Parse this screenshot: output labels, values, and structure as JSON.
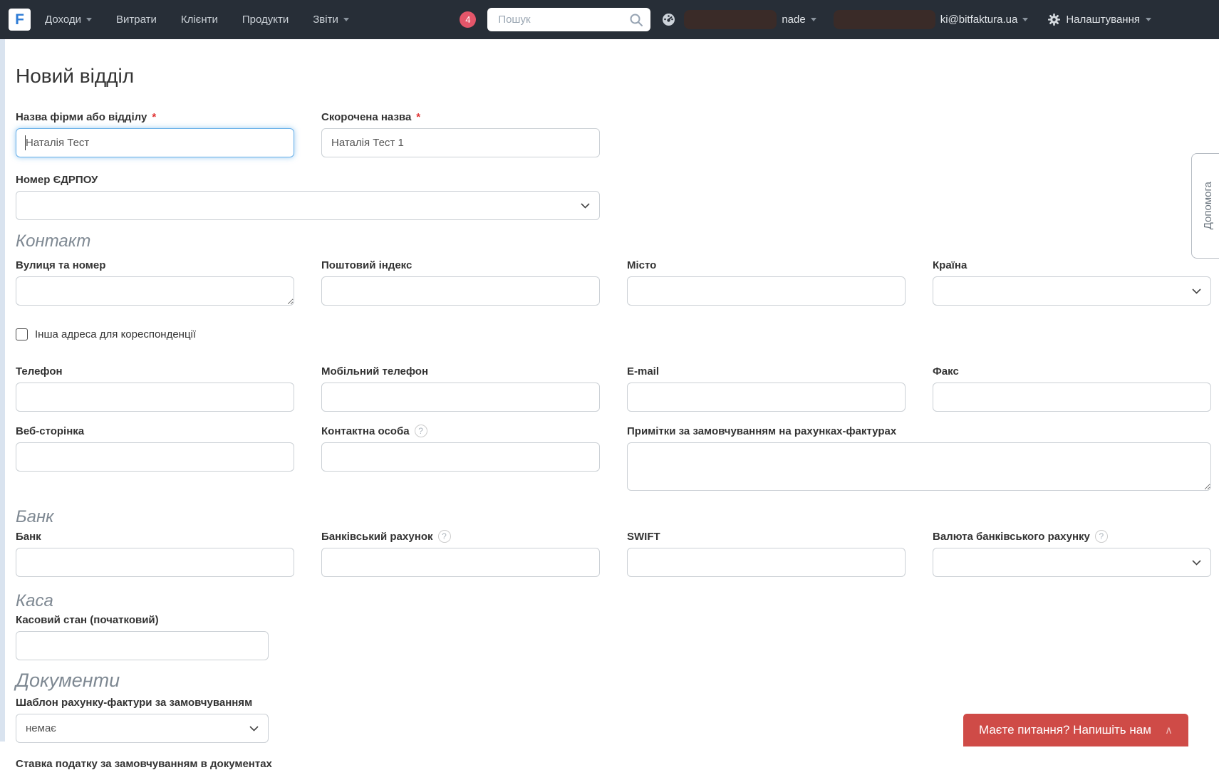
{
  "navbar": {
    "logo_letter": "F",
    "menu_items": [
      {
        "label": "Доходи"
      },
      {
        "label": "Витрати"
      },
      {
        "label": "Клієнти"
      },
      {
        "label": "Продукти"
      },
      {
        "label": "Звіти"
      }
    ],
    "notification_badge": "4",
    "search": {
      "placeholder": "Пошук"
    },
    "account_text": "nade",
    "user_email": "ki@bitfaktura.ua",
    "settings_label": "Налаштування"
  },
  "page": {
    "title": "Новий відділ",
    "help_tab_label": "Допомога"
  },
  "form": {
    "required_mark": "*",
    "help_mark": "?",
    "company_name": {
      "label": "Назва фірми або відділу",
      "value": "Наталія Тест"
    },
    "short_name": {
      "label": "Скорочена назва",
      "value": "Наталія Тест 1"
    },
    "edrpou": {
      "label": "Номер ЄДРПОУ",
      "value": ""
    },
    "section_contact": "Контакт",
    "street": {
      "label": "Вулиця та номер",
      "value": ""
    },
    "postcode": {
      "label": "Поштовий індекс",
      "value": ""
    },
    "city": {
      "label": "Місто",
      "value": ""
    },
    "country": {
      "label": "Країна",
      "value": ""
    },
    "other_address": {
      "label": "Інша адреса для кореспонденції"
    },
    "phone": {
      "label": "Телефон",
      "value": ""
    },
    "mobile_phone": {
      "label": "Мобільний телефон",
      "value": ""
    },
    "email": {
      "label": "E-mail",
      "value": ""
    },
    "fax": {
      "label": "Факс",
      "value": ""
    },
    "website": {
      "label": "Веб-сторінка",
      "value": ""
    },
    "contact_person": {
      "label": "Контактна особа",
      "value": ""
    },
    "invoice_notes": {
      "label": "Примітки за замовчуванням на рахунках-фактурах",
      "value": ""
    },
    "section_bank": "Банк",
    "bank": {
      "label": "Банк",
      "value": ""
    },
    "bank_account": {
      "label": "Банківський рахунок",
      "value": ""
    },
    "swift": {
      "label": "SWIFT",
      "value": ""
    },
    "bank_currency": {
      "label": "Валюта банківського рахунку",
      "value": ""
    },
    "section_cash": "Каса",
    "cash_state": {
      "label": "Касовий стан (початковий)",
      "value": ""
    },
    "section_documents": "Документи",
    "invoice_template": {
      "label": "Шаблон рахунку-фактури за замовчуванням",
      "value": "немає"
    },
    "default_tax": {
      "label": "Ставка податку за замовчуванням в документах"
    }
  },
  "footer": {
    "contact_button": "Маєте питання? Напишіть нам",
    "collapse_caret": "∧"
  },
  "colors": {
    "navbar_bg": "#272e37",
    "badge_red": "#e4566a",
    "focus_blue": "#66afe9",
    "button_red": "#cf4b47",
    "left_strip": "#d9e3ef"
  }
}
